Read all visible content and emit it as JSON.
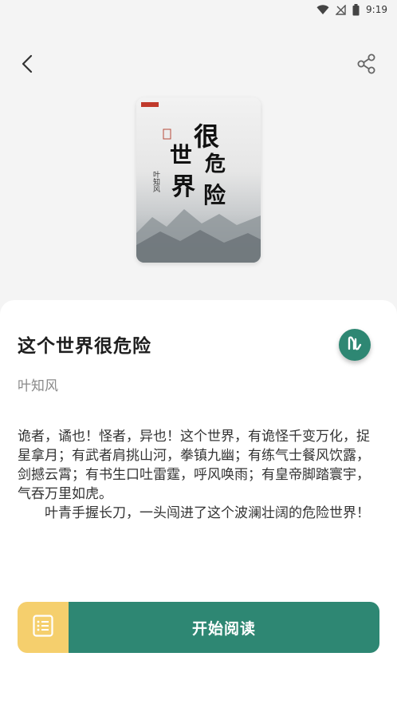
{
  "status_bar": {
    "time": "9:19",
    "icons": [
      "wifi-icon",
      "no-signal-icon",
      "battery-icon"
    ]
  },
  "header": {
    "back_icon": "chevron-left-icon",
    "share_icon": "share-icon"
  },
  "book": {
    "cover_title_chars": [
      "很",
      "危",
      "险",
      "世",
      "界"
    ],
    "cover_author": "叶知风",
    "title": "这个世界很危险",
    "author": "叶知风",
    "description": [
      "诡者，谲也！怪者，异也！这个世界，有诡怪千变万化，捉星拿月；有武者肩挑山河，拳镇九幽；有练气士餐风饮露，剑撼云霄；有书生口吐雷霆，呼风唤雨；有皇帝脚踏寰宇，气吞万里如虎。",
      "叶青手握长刀，一头闯进了这个波澜壮阔的危险世界！"
    ]
  },
  "actions": {
    "fab_icon": "reader-app-icon",
    "toc_icon": "table-of-contents-icon",
    "read_label": "开始阅读"
  },
  "colors": {
    "accent": "#2e8773",
    "toc_bg": "#f5cf6d",
    "page_bg": "#f4f4f4"
  }
}
